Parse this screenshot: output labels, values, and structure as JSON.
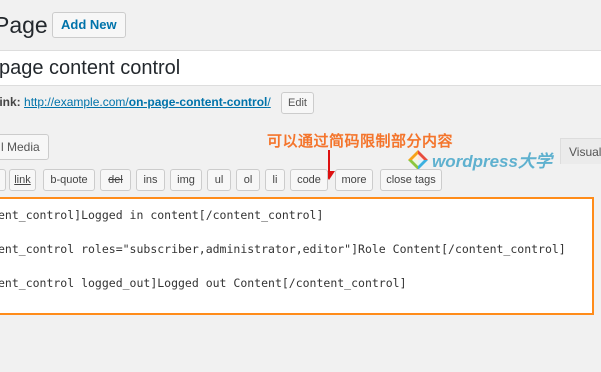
{
  "header": {
    "title": "Page",
    "add_new_label": "Add New"
  },
  "post_title": {
    "value": "page content control"
  },
  "permalink": {
    "label": "link:",
    "url_base": "http://example.com/",
    "slug": "on-page-content-control",
    "url_tail": "/",
    "edit_label": "Edit"
  },
  "media": {
    "add_media_label": "l Media"
  },
  "annotation": {
    "text": "可以通过简码限制部分内容",
    "color": "#f4752c"
  },
  "watermark": {
    "brand": "wordpress大学",
    "logo_icon": "wordpress-daxue-logo-icon"
  },
  "editor_tabs": {
    "visual_label": "Visual"
  },
  "quicktags": [
    {
      "id": "i",
      "label": "i"
    },
    {
      "id": "link",
      "label": "link"
    },
    {
      "id": "b-quote",
      "label": "b-quote"
    },
    {
      "id": "del",
      "label": "del"
    },
    {
      "id": "ins",
      "label": "ins"
    },
    {
      "id": "img",
      "label": "img"
    },
    {
      "id": "ul",
      "label": "ul"
    },
    {
      "id": "ol",
      "label": "ol"
    },
    {
      "id": "li",
      "label": "li"
    },
    {
      "id": "code",
      "label": "code"
    },
    {
      "id": "more",
      "label": "more"
    },
    {
      "id": "close-tags",
      "label": "close tags"
    }
  ],
  "content": {
    "lines": [
      "ent_control]Logged in content[/content_control]",
      "ent_control roles=\"subscriber,administrator,editor\"]Role Content[/content_control]",
      "ent_control logged_out]Logged out Content[/content_control]"
    ]
  },
  "colors": {
    "accent": "#0073aa",
    "highlight_border": "#ff8c1a",
    "arrow": "#dd1111"
  }
}
